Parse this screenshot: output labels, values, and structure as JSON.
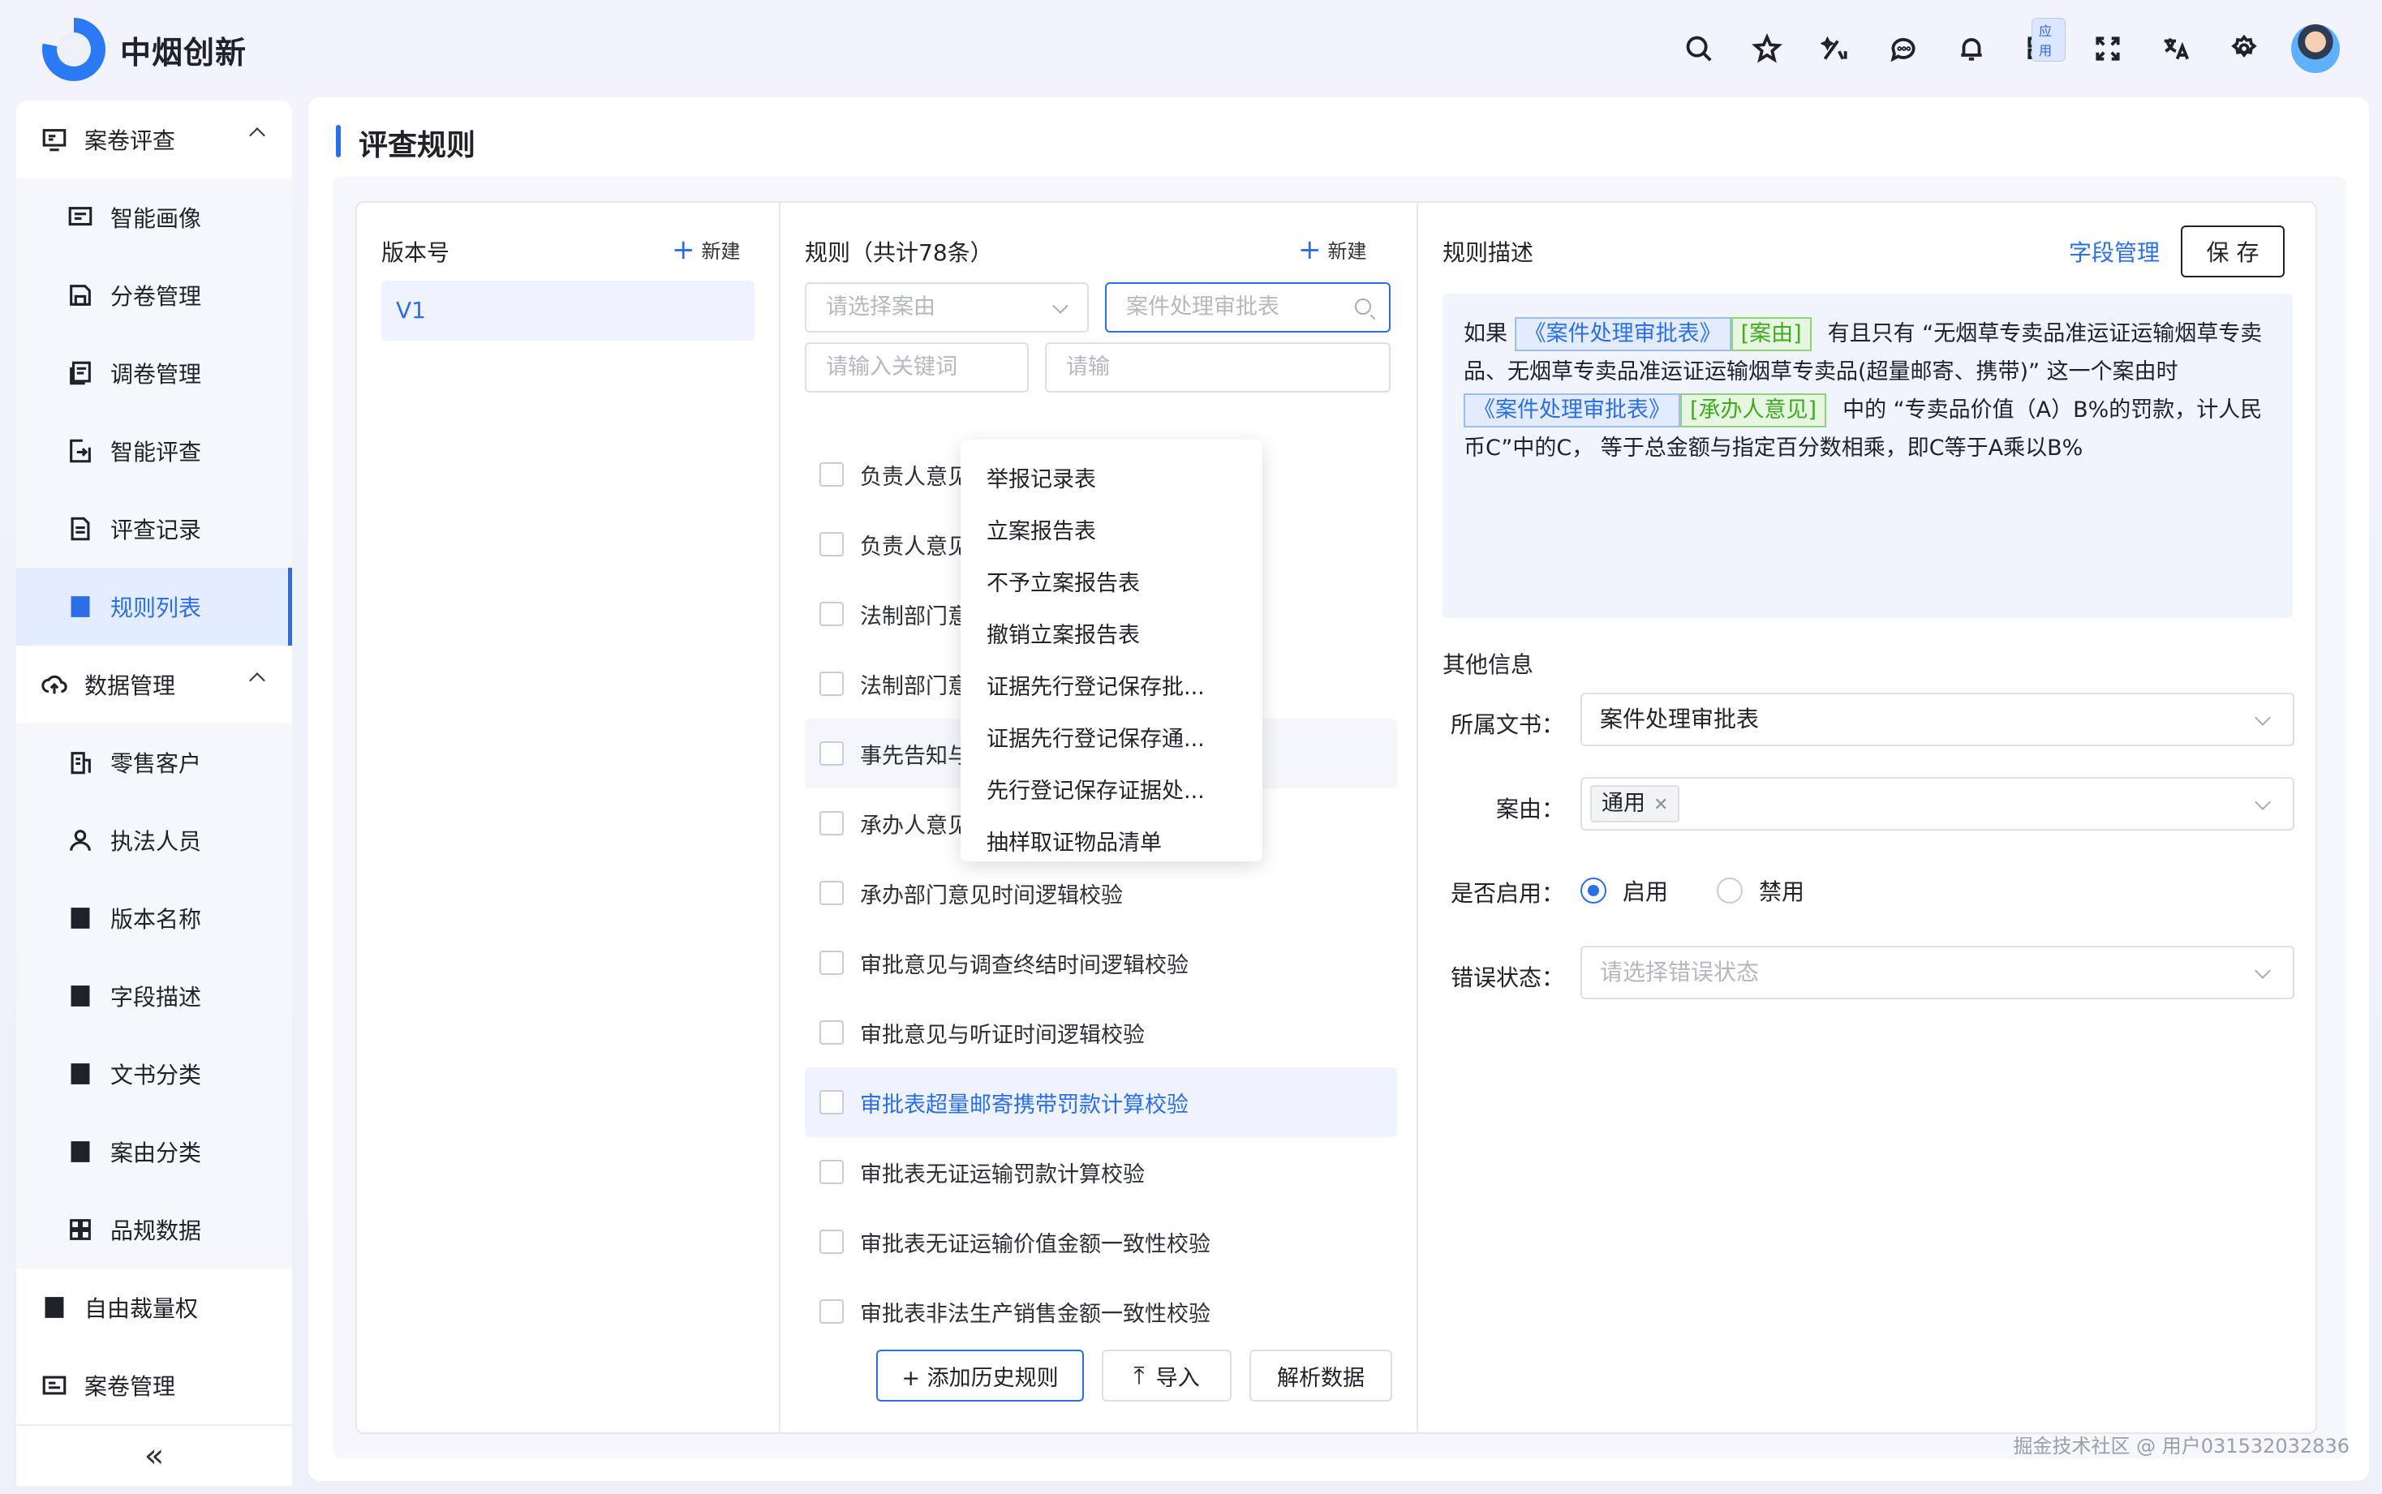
{
  "app": {
    "logo_text": "中烟创新",
    "apps_badge": "应用"
  },
  "sidebar": {
    "groups": [
      {
        "label": "案卷评查"
      },
      {
        "label": "数据管理"
      }
    ],
    "items_case": [
      "智能画像",
      "分卷管理",
      "调卷管理",
      "智能评查",
      "评查记录",
      "规则列表"
    ],
    "items_data": [
      "零售客户",
      "执法人员",
      "版本名称",
      "字段描述",
      "文书分类",
      "案由分类",
      "品规数据"
    ],
    "items_top": [
      "自由裁量权",
      "案卷管理"
    ],
    "collapse": "«"
  },
  "page": {
    "title": "评查规则"
  },
  "versions": {
    "header": "版本号",
    "new_label": "新建",
    "items": [
      "V1"
    ]
  },
  "rules": {
    "header": "规则（共计78条）",
    "new_label": "新建",
    "case_select_placeholder": "请选择案由",
    "doc_select_placeholder": "案件处理审批表",
    "keyword_placeholder": "请输入关键词",
    "keyword2_placeholder": "请输",
    "list": [
      "负责人意见时间逻辑校验",
      "负责人意见时间逻辑校验",
      "法制部门意见时间逻辑校",
      "法制部门意见时间逻辑校",
      "事先告知与承办部门意见",
      "承办人意见时间逻辑校验",
      "承办部门意见时间逻辑校验",
      "审批意见与调查终结时间逻辑校验",
      "审批意见与听证时间逻辑校验",
      "审批表超量邮寄携带罚款计算校验",
      "审批表无证运输罚款计算校验",
      "审批表无证运输价值金额一致性校验",
      "审批表非法生产销售金额一致性校验"
    ],
    "dropdown": [
      "举报记录表",
      "立案报告表",
      "不予立案报告表",
      "撤销立案报告表",
      "证据先行登记保存批...",
      "证据先行登记保存通...",
      "先行登记保存证据处...",
      "抽样取证物品清单"
    ],
    "add_history": "+ 添加历史规则",
    "import": "导入",
    "parse": "解析数据"
  },
  "detail": {
    "header": "规则描述",
    "field_mgr": "字段管理",
    "save": "保 存",
    "desc": {
      "p1": "如果",
      "tag1": "《案件处理审批表》",
      "tag2": "[案由]",
      "p2": "有且只有 “无烟草专卖品准运证运输烟草专卖品、无烟草专卖品准运证运输烟草专卖品(超量邮寄、携带)” 这一个案由时",
      "tag3": "《案件处理审批表》",
      "tag4": "[承办人意见]",
      "p3": "中的 “专卖品价值（A）B%的罚款，计人民币C”中的C， 等于总金额与指定百分数相乘，即C等于A乘以B%"
    },
    "other_header": "其他信息",
    "doc_label": "所属文书：",
    "doc_value": "案件处理审批表",
    "case_label": "案由：",
    "case_chip": "通用",
    "enable_label": "是否启用：",
    "enable_on": "启用",
    "enable_off": "禁用",
    "error_label": "错误状态：",
    "error_placeholder": "请选择错误状态"
  },
  "watermark": "掘金技术社区 @ 用户031532032836",
  "colors": {
    "accent": "#2a6fe8",
    "tag_green": "#3eaa1f"
  }
}
